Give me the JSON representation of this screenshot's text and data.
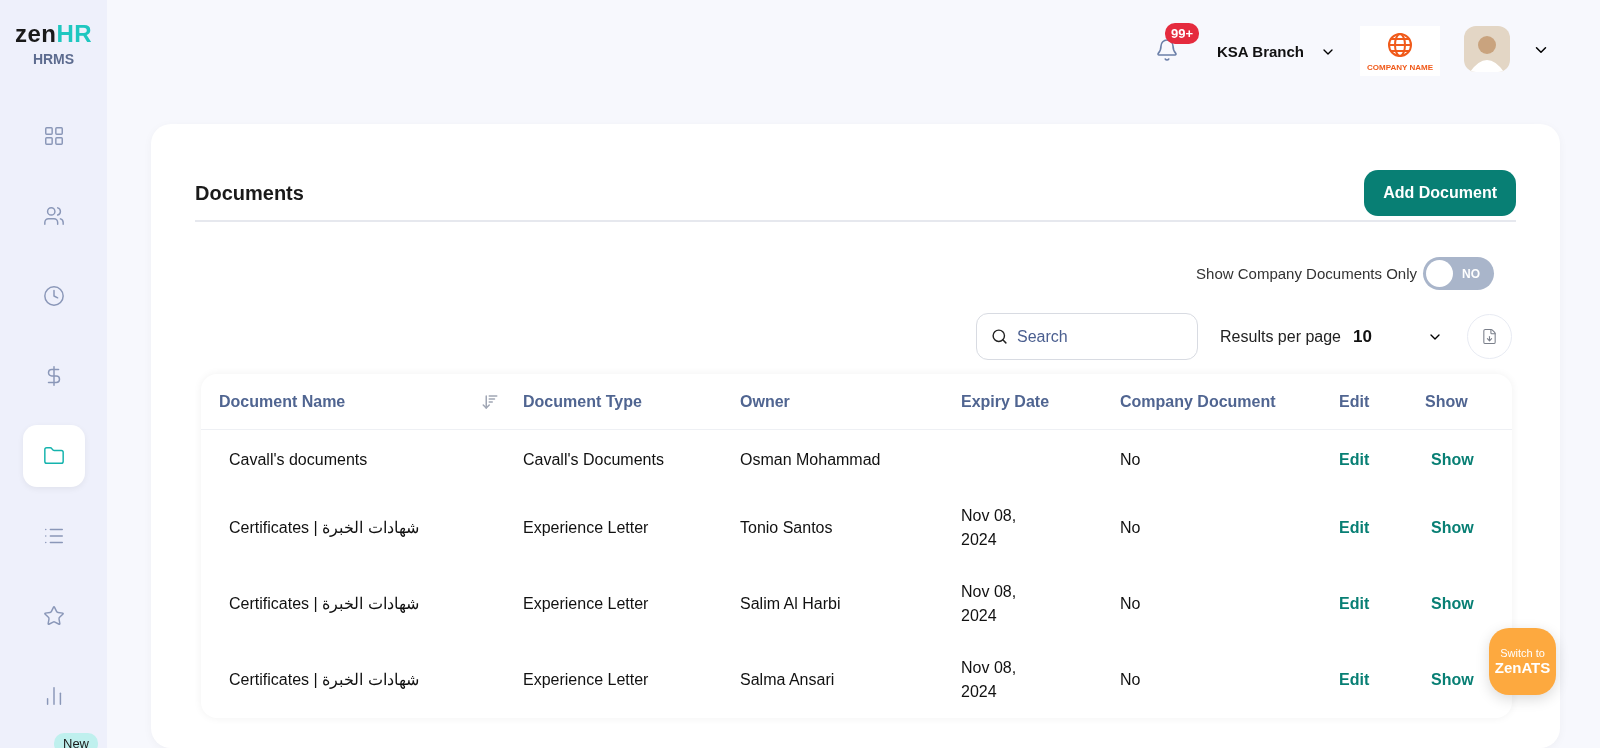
{
  "sidebar": {
    "logo": {
      "part_1": "zen",
      "part_2": "HR"
    },
    "subtitle": "HRMS",
    "items": [
      {
        "selected": false
      },
      {
        "selected": false
      },
      {
        "selected": false
      },
      {
        "selected": false
      },
      {
        "selected": true
      },
      {
        "selected": false
      },
      {
        "selected": false
      },
      {
        "selected": false
      }
    ],
    "new_badge": "New"
  },
  "header": {
    "notifications": "99+",
    "branch": "KSA Branch",
    "company_logo": "COMPANY NAME"
  },
  "page": {
    "title": "Documents",
    "add_button": "Add Document",
    "toggle": {
      "label": "Show Company Documents Only",
      "on": false,
      "state_text": "NO"
    },
    "search": {
      "placeholder": "Search"
    },
    "results_per_page": {
      "label": "Results per page",
      "value": "10"
    }
  },
  "table": {
    "columns": [
      "Document Name",
      "Document Type",
      "Owner",
      "Expiry Date",
      "Company Document",
      "Edit",
      "Show"
    ],
    "rows": [
      {
        "name": "Cavall's documents",
        "type": "Cavall's Documents",
        "owner": "Osman Mohammad",
        "expiry": "",
        "company": "No",
        "edit": "Edit",
        "show": "Show"
      },
      {
        "name": "Certificates | شهادات الخبرة",
        "type": "Experience Letter",
        "owner": "Tonio Santos",
        "expiry": "Nov 08, 2024",
        "company": "No",
        "edit": "Edit",
        "show": "Show"
      },
      {
        "name": "Certificates | شهادات الخبرة",
        "type": "Experience Letter",
        "owner": "Salim Al Harbi",
        "expiry": "Nov 08, 2024",
        "company": "No",
        "edit": "Edit",
        "show": "Show"
      },
      {
        "name": "Certificates | شهادات الخبرة",
        "type": "Experience Letter",
        "owner": "Salma Ansari",
        "expiry": "Nov 08, 2024",
        "company": "No",
        "edit": "Edit",
        "show": "Show"
      }
    ]
  },
  "switch_button": {
    "line_1": "Switch to",
    "line_2": "ZenATS"
  }
}
